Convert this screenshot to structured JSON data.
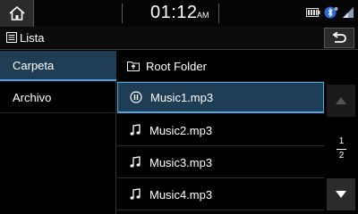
{
  "status": {
    "time": "01:12",
    "ampm": "AM",
    "icons": [
      "home-icon",
      "battery-icon",
      "bluetooth-icon",
      "signal-icon"
    ]
  },
  "header": {
    "title": "Lista",
    "title_icon": "list-icon",
    "back_icon": "back-arrow-icon"
  },
  "categories": [
    {
      "label": "Carpeta",
      "selected": true
    },
    {
      "label": "Archivo",
      "selected": false
    }
  ],
  "folder": {
    "label": "Root Folder",
    "icon": "folder-up-icon"
  },
  "files": [
    {
      "name": "Music1.mp3",
      "icon": "pause-icon",
      "selected": true
    },
    {
      "name": "Music2.mp3",
      "icon": "music-note-icon",
      "selected": false
    },
    {
      "name": "Music3.mp3",
      "icon": "music-note-icon",
      "selected": false
    },
    {
      "name": "Music4.mp3",
      "icon": "music-note-icon",
      "selected": false
    }
  ],
  "pager": {
    "current": "1",
    "total": "2"
  },
  "colors": {
    "selected_bg": "#1f3e55",
    "accent": "#4aa8e8"
  }
}
